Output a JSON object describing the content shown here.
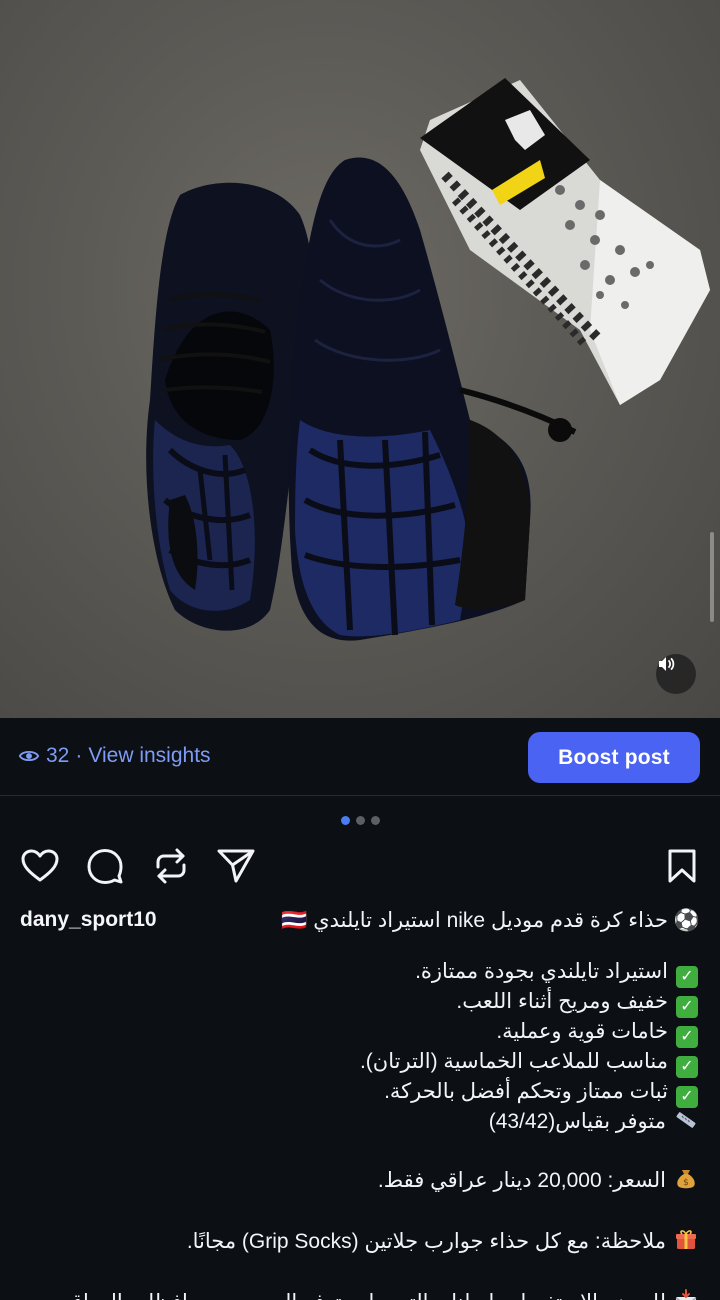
{
  "post": {
    "username": "dany_sport10",
    "headline": "⚽ حذاء كرة قدم موديل nike استيراد تايلندي 🇹🇭"
  },
  "insights": {
    "views": "32",
    "separator": "·",
    "link_label": "View insights"
  },
  "boost": {
    "label": "Boost post"
  },
  "carousel": {
    "dots": 3,
    "active_index": 0
  },
  "caption": {
    "features": [
      "استيراد تايلندي بجودة ممتازة.",
      "خفيف ومريح أثناء اللعب.",
      "خامات قوية وعملية.",
      "مناسب للملاعب الخماسية (الترتان).",
      "ثبات ممتاز وتحكم أفضل بالحركة."
    ],
    "sizes": "متوفر بقياس(43/42)",
    "price": "السعر: 20,000 دينار عراقي فقط.",
    "note": "ملاحظة: مع كل حذاء جوارب جلاتين (Grip Socks) مجانًا.",
    "contact": "للحجز والاستفسار راسلنا، والتوصيل متوفر إلى جميع محافظات العراق"
  },
  "icons": {
    "check": "check-mark-icon",
    "ruler": "ruler-icon",
    "money_bag": "money-bag-icon",
    "gift": "gift-icon",
    "envelope": "incoming-envelope-icon",
    "football": "soccer-ball-icon",
    "flag": "thailand-flag-icon"
  },
  "colors": {
    "background": "#0c0f14",
    "accent": "#4a63f2",
    "link": "#7f9cf5",
    "check_green": "#3fae3f"
  }
}
